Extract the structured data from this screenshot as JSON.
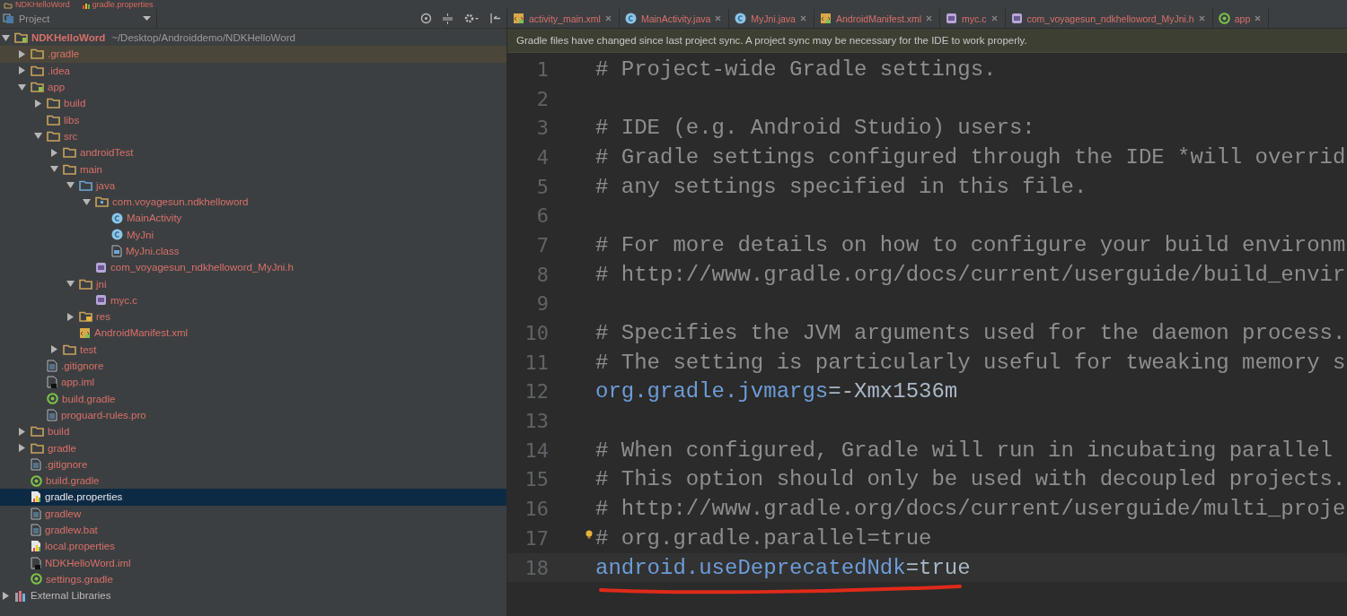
{
  "breadcrumb": [
    {
      "label": "NDKHelloWord",
      "kind": "folder"
    },
    {
      "label": "gradle.properties",
      "kind": "properties"
    }
  ],
  "project_panel": {
    "title": "Project"
  },
  "tree": [
    {
      "label": "NDKHelloWord",
      "path": "~/Desktop/Androiddemo/NDKHelloWord",
      "kind": "module",
      "expanded": true,
      "selected": false,
      "highlighted": false,
      "unversioned": true,
      "children": [
        {
          "label": ".gradle",
          "kind": "folder",
          "expanded": false,
          "selected": false,
          "highlighted": true,
          "unversioned": true
        },
        {
          "label": ".idea",
          "kind": "folder",
          "expanded": false,
          "selected": false,
          "highlighted": false,
          "unversioned": true
        },
        {
          "label": "app",
          "kind": "module",
          "expanded": true,
          "selected": false,
          "highlighted": false,
          "unversioned": true,
          "children": [
            {
              "label": "build",
              "kind": "folder",
              "expanded": false,
              "selected": false,
              "highlighted": false,
              "unversioned": true
            },
            {
              "label": "libs",
              "kind": "folder",
              "selected": false,
              "highlighted": false,
              "unversioned": true
            },
            {
              "label": "src",
              "kind": "folder",
              "expanded": true,
              "selected": false,
              "highlighted": false,
              "unversioned": true,
              "children": [
                {
                  "label": "androidTest",
                  "kind": "folder",
                  "expanded": false,
                  "selected": false,
                  "highlighted": false,
                  "unversioned": true
                },
                {
                  "label": "main",
                  "kind": "folder",
                  "expanded": true,
                  "selected": false,
                  "highlighted": false,
                  "unversioned": true,
                  "children": [
                    {
                      "label": "java",
                      "kind": "source",
                      "expanded": true,
                      "selected": false,
                      "highlighted": false,
                      "unversioned": true,
                      "children": [
                        {
                          "label": "com.voyagesun.ndkhelloword",
                          "kind": "package",
                          "expanded": true,
                          "selected": false,
                          "highlighted": false,
                          "unversioned": true,
                          "children": [
                            {
                              "label": "MainActivity",
                              "kind": "class",
                              "selected": false,
                              "highlighted": false,
                              "unversioned": true
                            },
                            {
                              "label": "MyJni",
                              "kind": "class",
                              "selected": false,
                              "highlighted": false,
                              "unversioned": true
                            },
                            {
                              "label": "MyJni.class",
                              "kind": "binary",
                              "selected": false,
                              "highlighted": false,
                              "unversioned": true
                            }
                          ]
                        },
                        {
                          "label": "com_voyagesun_ndkhelloword_MyJni.h",
                          "kind": "c",
                          "selected": false,
                          "highlighted": false,
                          "unversioned": true
                        }
                      ]
                    },
                    {
                      "label": "jni",
                      "kind": "folder",
                      "expanded": true,
                      "selected": false,
                      "highlighted": false,
                      "unversioned": true,
                      "children": [
                        {
                          "label": "myc.c",
                          "kind": "c",
                          "selected": false,
                          "highlighted": false,
                          "unversioned": true
                        }
                      ]
                    },
                    {
                      "label": "res",
                      "kind": "resources",
                      "expanded": false,
                      "selected": false,
                      "highlighted": false,
                      "unversioned": true
                    },
                    {
                      "label": "AndroidManifest.xml",
                      "kind": "manifest",
                      "selected": false,
                      "highlighted": false,
                      "unversioned": true
                    }
                  ]
                },
                {
                  "label": "test",
                  "kind": "folder",
                  "expanded": false,
                  "selected": false,
                  "highlighted": false,
                  "unversioned": true
                }
              ]
            },
            {
              "label": ".gitignore",
              "kind": "text",
              "selected": false,
              "highlighted": false,
              "unversioned": true
            },
            {
              "label": "app.iml",
              "kind": "iml",
              "selected": false,
              "highlighted": false,
              "unversioned": true
            },
            {
              "label": "build.gradle",
              "kind": "gradle",
              "selected": false,
              "highlighted": false,
              "unversioned": true
            },
            {
              "label": "proguard-rules.pro",
              "kind": "text",
              "selected": false,
              "highlighted": false,
              "unversioned": true
            }
          ]
        },
        {
          "label": "build",
          "kind": "folder",
          "expanded": false,
          "selected": false,
          "highlighted": false,
          "unversioned": true
        },
        {
          "label": "gradle",
          "kind": "folder",
          "expanded": false,
          "selected": false,
          "highlighted": false,
          "unversioned": true
        },
        {
          "label": ".gitignore",
          "kind": "text",
          "selected": false,
          "highlighted": false,
          "unversioned": true
        },
        {
          "label": "build.gradle",
          "kind": "gradle",
          "selected": false,
          "highlighted": false,
          "unversioned": true
        },
        {
          "label": "gradle.properties",
          "kind": "properties",
          "selected": true,
          "highlighted": false,
          "unversioned": false
        },
        {
          "label": "gradlew",
          "kind": "text",
          "selected": false,
          "highlighted": false,
          "unversioned": true
        },
        {
          "label": "gradlew.bat",
          "kind": "text",
          "selected": false,
          "highlighted": false,
          "unversioned": true
        },
        {
          "label": "local.properties",
          "kind": "properties",
          "selected": false,
          "highlighted": false,
          "unversioned": true
        },
        {
          "label": "NDKHelloWord.iml",
          "kind": "iml",
          "selected": false,
          "highlighted": false,
          "unversioned": true
        },
        {
          "label": "settings.gradle",
          "kind": "gradle",
          "selected": false,
          "highlighted": false,
          "unversioned": true
        }
      ]
    },
    {
      "label": "External Libraries",
      "kind": "libraries",
      "expanded": false,
      "selected": false,
      "highlighted": false,
      "unversioned": false
    }
  ],
  "tabs": [
    {
      "label": "activity_main.xml",
      "kind": "layout",
      "selected": false
    },
    {
      "label": "MainActivity.java",
      "kind": "class",
      "selected": false
    },
    {
      "label": "MyJni.java",
      "kind": "class",
      "selected": false
    },
    {
      "label": "AndroidManifest.xml",
      "kind": "manifest",
      "selected": false
    },
    {
      "label": "myc.c",
      "kind": "c",
      "selected": false
    },
    {
      "label": "com_voyagesun_ndkhelloword_MyJni.h",
      "kind": "c",
      "selected": false
    },
    {
      "label": "app",
      "kind": "gradle",
      "selected": false
    }
  ],
  "notification": "Gradle files have changed since last project sync. A project sync may be necessary for the IDE to work properly.",
  "editor": {
    "lines": [
      {
        "number": "1",
        "kind": "comment",
        "text": "# Project-wide Gradle settings."
      },
      {
        "number": "2",
        "kind": "empty"
      },
      {
        "number": "3",
        "kind": "comment",
        "text": "# IDE (e.g. Android Studio) users:"
      },
      {
        "number": "4",
        "kind": "comment",
        "text": "# Gradle settings configured through the IDE *will overrid"
      },
      {
        "number": "5",
        "kind": "comment",
        "text": "# any settings specified in this file."
      },
      {
        "number": "6",
        "kind": "empty"
      },
      {
        "number": "7",
        "kind": "comment",
        "text": "# For more details on how to configure your build environm"
      },
      {
        "number": "8",
        "kind": "comment",
        "text": "# http://www.gradle.org/docs/current/userguide/build_envir"
      },
      {
        "number": "9",
        "kind": "empty"
      },
      {
        "number": "10",
        "kind": "comment",
        "text": "# Specifies the JVM arguments used for the daemon process."
      },
      {
        "number": "11",
        "kind": "comment",
        "text": "# The setting is particularly useful for tweaking memory s"
      },
      {
        "number": "12",
        "kind": "property",
        "key": "org.gradle.jvmargs",
        "separator": "=",
        "value": "-Xmx1536m"
      },
      {
        "number": "13",
        "kind": "empty"
      },
      {
        "number": "14",
        "kind": "comment",
        "text": "# When configured, Gradle will run in incubating parallel"
      },
      {
        "number": "15",
        "kind": "comment",
        "text": "# This option should only be used with decoupled projects."
      },
      {
        "number": "16",
        "kind": "comment",
        "text": "# http://www.gradle.org/docs/current/userguide/multi_proje"
      },
      {
        "number": "17",
        "kind": "comment",
        "text": "# org.gradle.parallel=true",
        "intention": true
      },
      {
        "number": "18",
        "kind": "property",
        "key": "android.useDeprecatedNdk",
        "separator": "=",
        "value": "true",
        "current": true,
        "underlined": true
      }
    ]
  }
}
